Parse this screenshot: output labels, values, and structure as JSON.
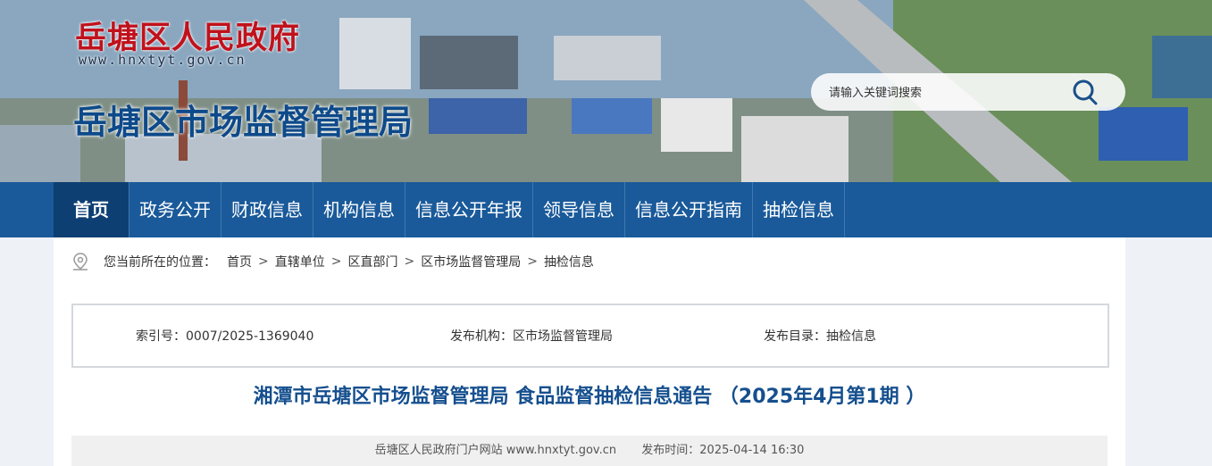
{
  "header": {
    "gov_title": "岳塘区人民政府",
    "gov_url": "www.hnxtyt.gov.cn",
    "bureau_title": "岳塘区市场监督管理局",
    "search_placeholder": "请输入关键词搜索",
    "search_icon": "magnifier-icon"
  },
  "nav": {
    "items": [
      "首页",
      "政务公开",
      "财政信息",
      "机构信息",
      "信息公开年报",
      "领导信息",
      "信息公开指南",
      "抽检信息"
    ],
    "active": "首页"
  },
  "breadcrumb": {
    "icon": "location-pin-icon",
    "prefix": "您当前所在的位置：",
    "items": [
      "首页",
      "直辖单位",
      "区直部门",
      "区市场监督管理局",
      "抽检信息"
    ],
    "separator": ">"
  },
  "meta": {
    "index_no": "索引号：0007/2025-1369040",
    "publisher": "发布机构：区市场监督管理局",
    "catalog": "发布目录：抽检信息"
  },
  "article": {
    "title": "湘潭市岳塘区市场监督管理局 食品监督抽检信息通告 （2025年4月第1期 ）",
    "source": "岳塘区人民政府门户网站 www.hnxtyt.gov.cn",
    "publish_time": "发布时间：2025-04-14 16:30"
  },
  "colors": {
    "nav_bg": "#1a5a9a",
    "nav_active": "#0d3f73",
    "gov_title": "#c0121c",
    "article_title": "#154f8e"
  }
}
